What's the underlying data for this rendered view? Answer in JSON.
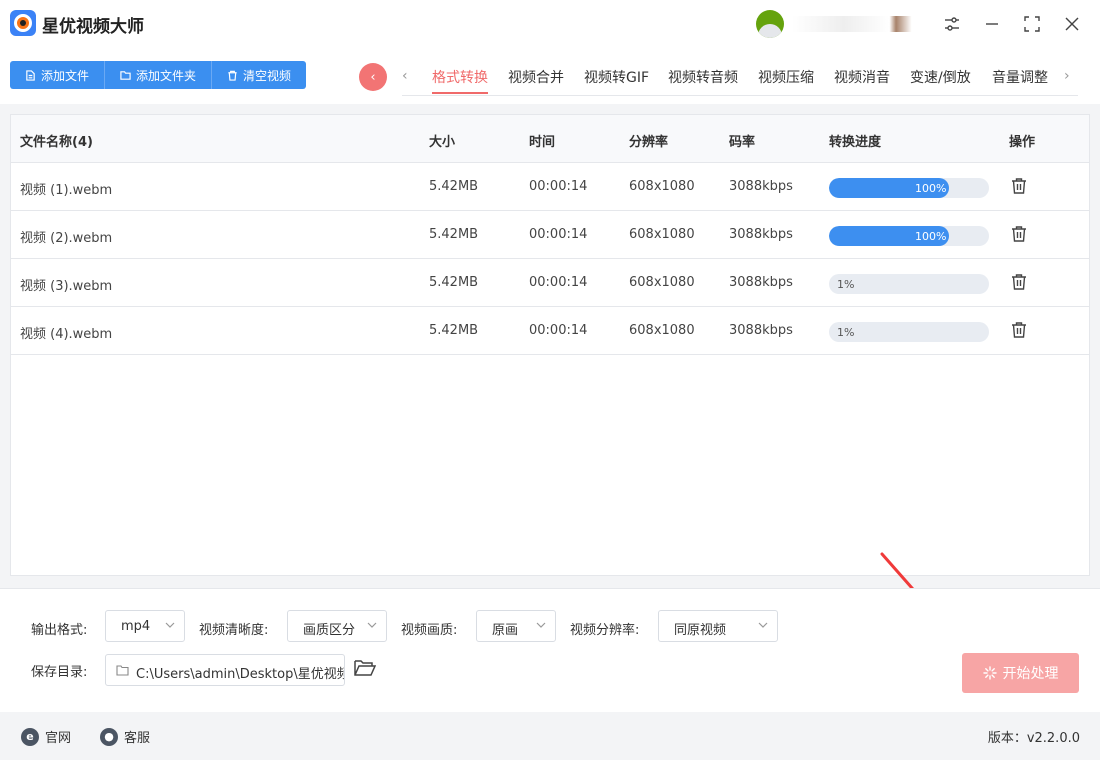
{
  "app": {
    "title": "星优视频大师"
  },
  "toolbar": {
    "add_file": "添加文件",
    "add_folder": "添加文件夹",
    "clear_videos": "清空视频"
  },
  "tabs": [
    "格式转换",
    "视频合并",
    "视频转GIF",
    "视频转音频",
    "视频压缩",
    "视频消音",
    "变速/倒放",
    "音量调整"
  ],
  "active_tab": "格式转换",
  "table": {
    "headers": {
      "name": "文件名称(4)",
      "size": "大小",
      "time": "时间",
      "resolution": "分辨率",
      "bitrate": "码率",
      "progress": "转换进度",
      "action": "操作"
    },
    "rows": [
      {
        "name": "视频 (1).webm",
        "size": "5.42MB",
        "time": "00:00:14",
        "resolution": "608x1080",
        "bitrate": "3088kbps",
        "progress": 1.0,
        "progress_label": "100%"
      },
      {
        "name": "视频 (2).webm",
        "size": "5.42MB",
        "time": "00:00:14",
        "resolution": "608x1080",
        "bitrate": "3088kbps",
        "progress": 1.0,
        "progress_label": "100%"
      },
      {
        "name": "视频 (3).webm",
        "size": "5.42MB",
        "time": "00:00:14",
        "resolution": "608x1080",
        "bitrate": "3088kbps",
        "progress": 0.01,
        "progress_label": "1%"
      },
      {
        "name": "视频 (4).webm",
        "size": "5.42MB",
        "time": "00:00:14",
        "resolution": "608x1080",
        "bitrate": "3088kbps",
        "progress": 0.01,
        "progress_label": "1%"
      }
    ]
  },
  "settings": {
    "output_format_label": "输出格式:",
    "output_format_value": "mp4",
    "clarity_label": "视频清晰度:",
    "clarity_value": "画质区分",
    "quality_label": "视频画质:",
    "quality_value": "原画",
    "resolution_label": "视频分辨率:",
    "resolution_value": "同原视频",
    "save_dir_label": "保存目录:",
    "save_dir_value": "C:\\Users\\admin\\Desktop\\星优视频",
    "start_button": "开始处理"
  },
  "footer": {
    "website": "官网",
    "support": "客服",
    "version": "版本：v2.2.0.0"
  },
  "colors": {
    "accent_blue": "#3b8ff0",
    "accent_red": "#f06a6a",
    "start_button": "#f7a5a5",
    "annotation_arrow": "#f03a3a"
  }
}
